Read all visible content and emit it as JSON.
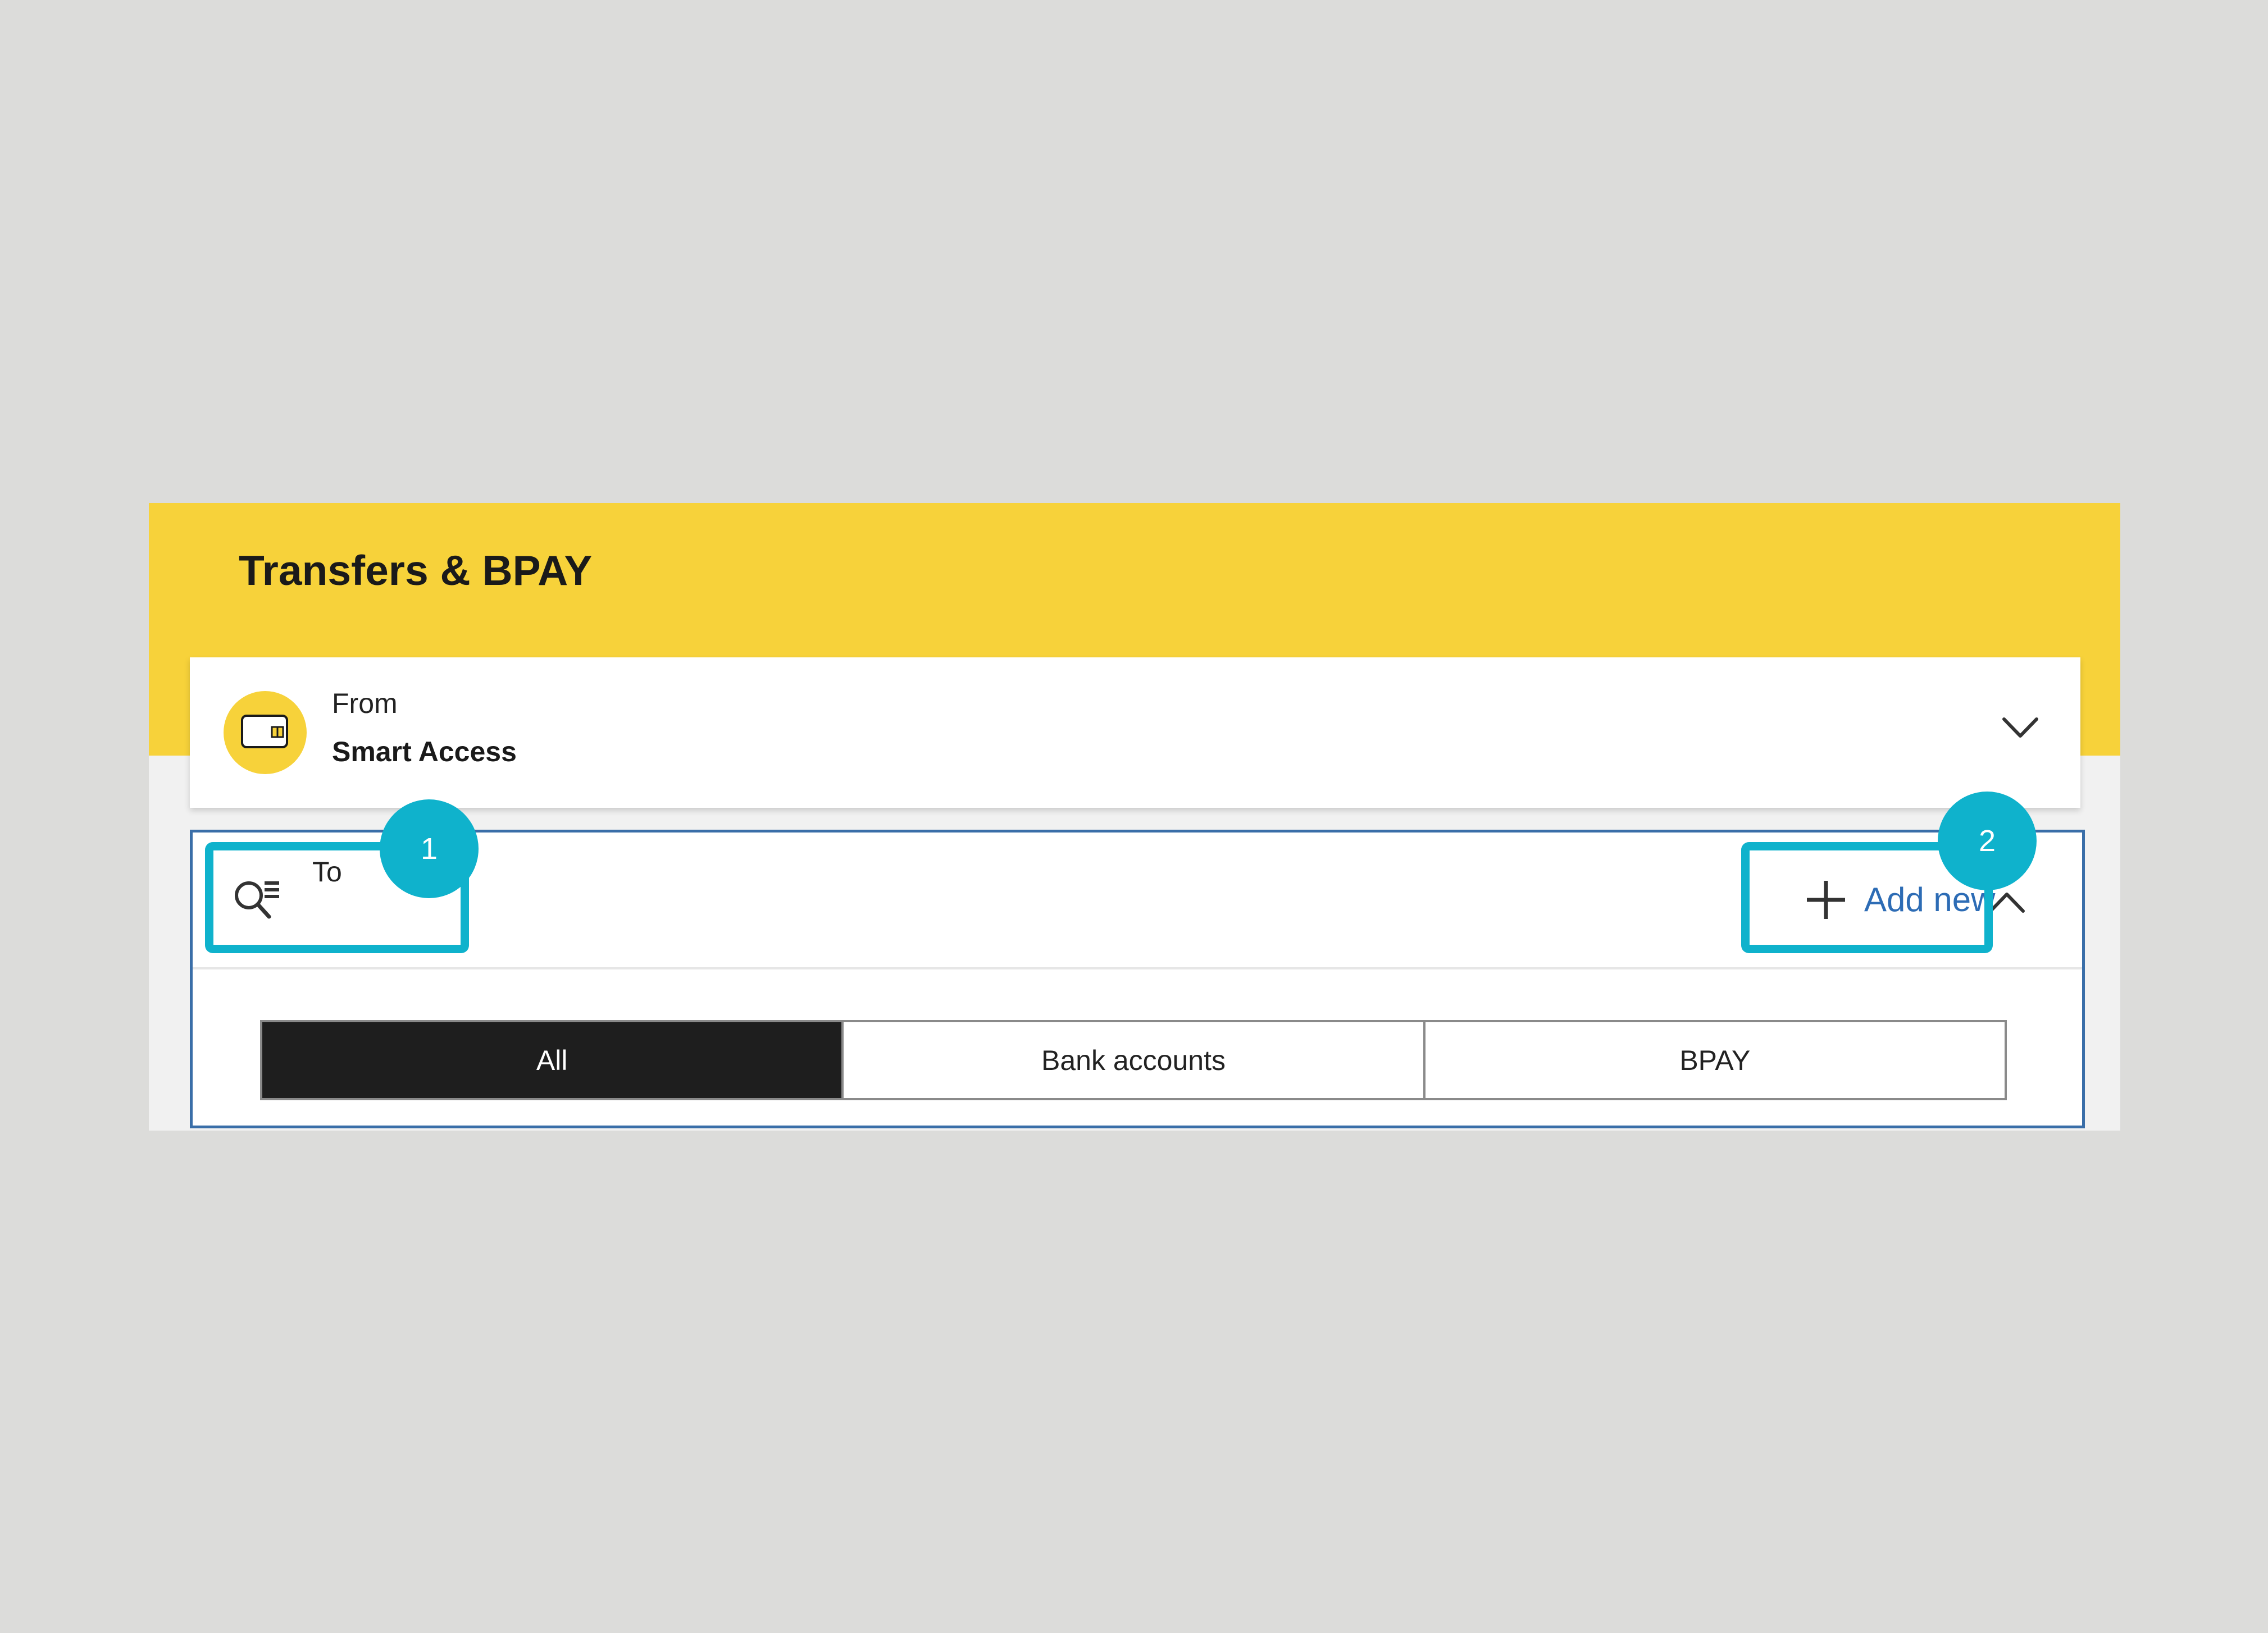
{
  "header": {
    "title": "Transfers & BPAY"
  },
  "from": {
    "label": "From",
    "account": "Smart Access",
    "icon": "wallet-icon"
  },
  "to": {
    "label": "To",
    "add_new_label": "Add new",
    "search_icon": "search-list-icon"
  },
  "filters": [
    {
      "label": "All",
      "active": true
    },
    {
      "label": "Bank accounts",
      "active": false
    },
    {
      "label": "BPAY",
      "active": false
    }
  ],
  "callouts": [
    "1",
    "2"
  ],
  "colors": {
    "brand_yellow": "#f7d23a",
    "link_blue": "#2d6cb5",
    "callout_teal": "#0fb2cc",
    "focus_border": "#3a6ea8"
  }
}
